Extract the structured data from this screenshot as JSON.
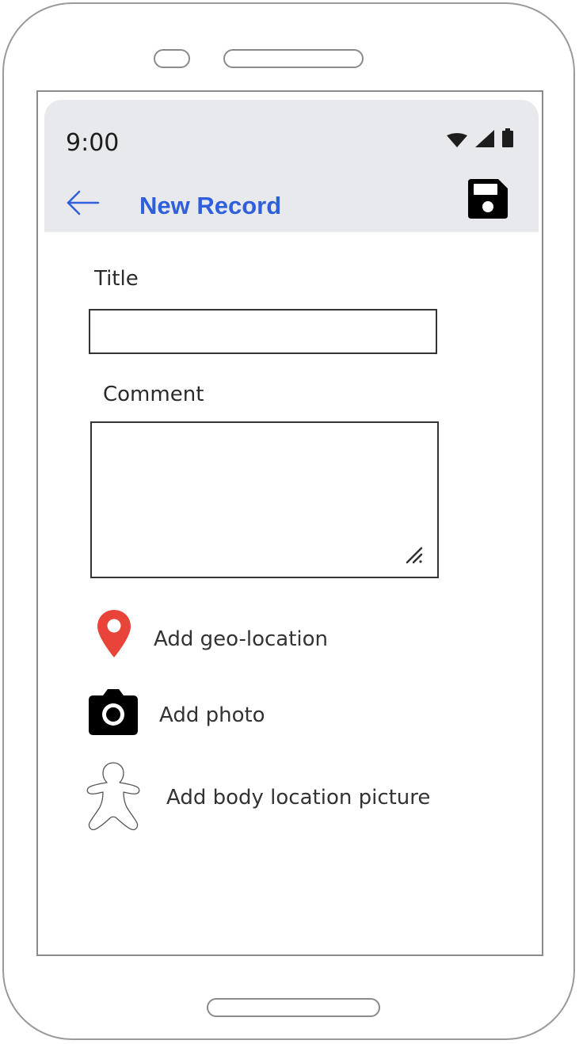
{
  "status_bar": {
    "time": "9:00",
    "icons": [
      "wifi-icon",
      "cell-signal-icon",
      "battery-icon"
    ]
  },
  "app_bar": {
    "back_icon": "arrow-left-icon",
    "title": "New Record",
    "save_icon": "floppy-disk-icon",
    "title_color": "#2f5fdb",
    "background_color": "#e8e9ec"
  },
  "form": {
    "title_label": "Title",
    "title_value": "",
    "comment_label": "Comment",
    "comment_value": ""
  },
  "actions": [
    {
      "label": "Add geo-location",
      "icon": "map-pin-icon",
      "icon_color": "#e8443a"
    },
    {
      "label": "Add photo",
      "icon": "camera-icon",
      "icon_color": "#000000"
    },
    {
      "label": "Add body location picture",
      "icon": "body-outline-icon",
      "icon_color": "#555555"
    }
  ]
}
